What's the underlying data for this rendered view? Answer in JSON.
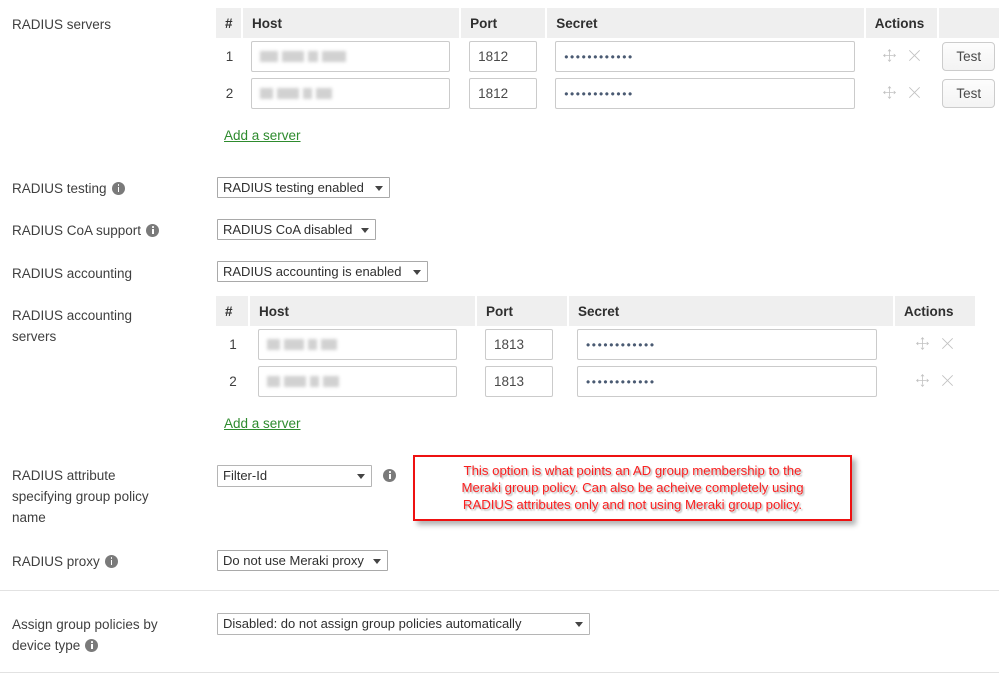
{
  "rows": {
    "radius_servers": {
      "label": "RADIUS servers",
      "add_link": "Add a server",
      "table": {
        "headers": [
          "#",
          "Host",
          "Port",
          "Secret",
          "Actions",
          ""
        ],
        "rows": [
          {
            "num": "1",
            "host": "",
            "host_redacted": true,
            "port": "1812",
            "secret": "••••••••••••",
            "actions": [
              "move-icon",
              "delete-icon"
            ],
            "test_label": "Test"
          },
          {
            "num": "2",
            "host": "",
            "host_redacted": true,
            "port": "1812",
            "secret": "••••••••••••",
            "actions": [
              "move-icon",
              "delete-icon"
            ],
            "test_label": "Test"
          }
        ]
      }
    },
    "radius_testing": {
      "label": "RADIUS testing",
      "has_info": true,
      "value": "RADIUS testing enabled"
    },
    "radius_coa": {
      "label": "RADIUS CoA support",
      "has_info": true,
      "value": "RADIUS CoA disabled"
    },
    "radius_accounting": {
      "label": "RADIUS accounting",
      "has_info": false,
      "value": "RADIUS accounting is enabled"
    },
    "radius_accounting_servers": {
      "label": "RADIUS accounting servers",
      "add_link": "Add a server",
      "table": {
        "headers": [
          "#",
          "Host",
          "Port",
          "Secret",
          "Actions"
        ],
        "rows": [
          {
            "num": "1",
            "host": "",
            "host_redacted": true,
            "port": "1813",
            "secret": "••••••••••••",
            "actions": [
              "move-icon",
              "delete-icon"
            ]
          },
          {
            "num": "2",
            "host": "",
            "host_redacted": true,
            "port": "1813",
            "secret": "••••••••••••",
            "actions": [
              "move-icon",
              "delete-icon"
            ]
          }
        ]
      }
    },
    "radius_attribute": {
      "label": "RADIUS attribute specifying group policy name",
      "has_info": true,
      "value": "Filter-Id"
    },
    "radius_proxy": {
      "label": "RADIUS proxy",
      "has_info": true,
      "value": "Do not use Meraki proxy"
    },
    "assign_group_policies": {
      "label": "Assign group policies by device type",
      "has_info": true,
      "value": "Disabled: do not assign group policies automatically"
    }
  },
  "annotation": {
    "line1": "This option is what points an AD group membership to the",
    "line2": "Meraki group policy.  Can also be acheive completely using",
    "line3": "RADIUS attributes only and not using Meraki group policy.",
    "border_color": "#ee1111",
    "text_color": "#fa2020"
  },
  "colors": {
    "link_green": "#2e8b2e",
    "header_bg": "#efefef",
    "input_border": "#cbcbcb",
    "text": "#3f3f3f"
  }
}
